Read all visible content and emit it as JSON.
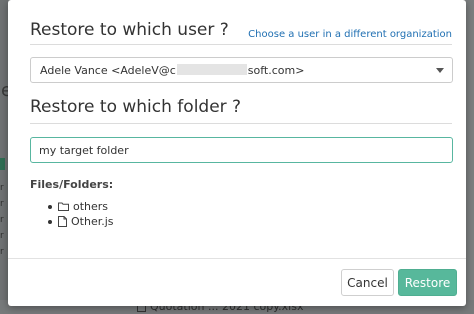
{
  "background": {
    "left_letter": "e",
    "left_marks": [
      "r",
      "r",
      "r",
      "r",
      "r"
    ],
    "bottom_text": "Quotation ... 2021 copy.xlsx"
  },
  "modal": {
    "user_section": {
      "title": "Restore to which user ?",
      "alt_link": "Choose a user in a different organization",
      "selected_user_prefix": "Adele Vance <AdeleV@c",
      "selected_user_suffix": "soft.com>"
    },
    "folder_section": {
      "title": "Restore to which folder ?",
      "folder_value": "my target folder"
    },
    "files": {
      "label": "Files/Folders:",
      "items": [
        {
          "icon": "folder-icon",
          "name": "others"
        },
        {
          "icon": "file-icon",
          "name": "Other.js"
        }
      ]
    },
    "buttons": {
      "cancel": "Cancel",
      "restore": "Restore"
    }
  },
  "colors": {
    "accent": "#57b89b",
    "link": "#1f6fb2",
    "focus_border": "#58b6a0"
  }
}
